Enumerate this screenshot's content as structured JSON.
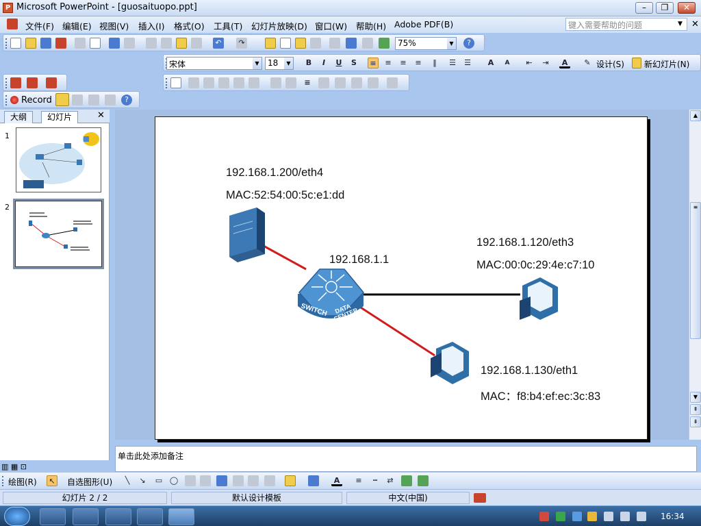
{
  "window": {
    "title": "Microsoft PowerPoint - [guosaituopo.ppt]"
  },
  "menu": {
    "items": [
      "文件(F)",
      "编辑(E)",
      "视图(V)",
      "插入(I)",
      "格式(O)",
      "工具(T)",
      "幻灯片放映(D)",
      "窗口(W)",
      "帮助(H)",
      "Adobe PDF(B)"
    ],
    "help_placeholder": "键入需要帮助的问题"
  },
  "standard_toolbar": {
    "zoom": "75%"
  },
  "format_toolbar": {
    "font": "宋体",
    "size": "18",
    "design": "设计(S)",
    "new_slide": "新幻灯片(N)"
  },
  "record_toolbar": {
    "record": "Record"
  },
  "left_pane": {
    "tabs": [
      "大纲",
      "幻灯片"
    ],
    "slide_numbers": [
      "1",
      "2"
    ]
  },
  "slide": {
    "labels": [
      {
        "text": "192.168.1.200/eth4"
      },
      {
        "text": "MAC:52:54:00:5c:e1:dd"
      },
      {
        "text": "192.168.1.1"
      },
      {
        "text": "192.168.1.120/eth3"
      },
      {
        "text": "MAC:00:0c:29:4e:c7:10"
      },
      {
        "text": "192.168.1.130/eth1"
      },
      {
        "text": "MAC：f8:b4:ef:ec:3c:83"
      }
    ],
    "switch_text": {
      "line1": "SWITCH",
      "line2": "DATA",
      "line3": "CENTER"
    },
    "colors": {
      "red_link": "#d01c1c",
      "black_link": "#000000",
      "device_blue": "#2f6fa8"
    }
  },
  "notes": {
    "placeholder": "单击此处添加备注"
  },
  "drawing_toolbar": {
    "draw": "绘图(R)",
    "autoshapes": "自选图形(U)"
  },
  "status": {
    "slide": "幻灯片 2 / 2",
    "template": "默认设计模板",
    "language": "中文(中国)"
  },
  "taskbar": {
    "time": "16:34"
  }
}
